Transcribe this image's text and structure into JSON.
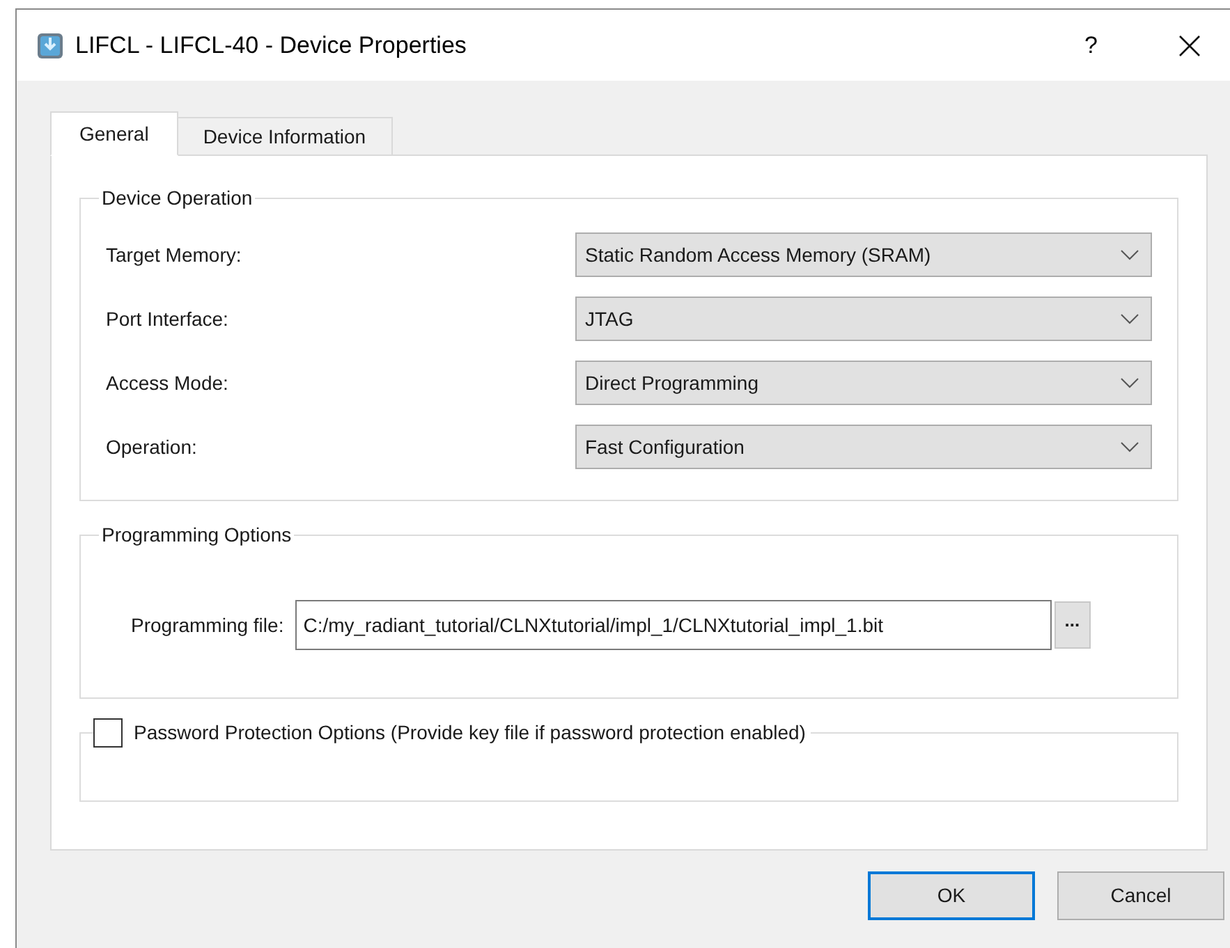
{
  "window": {
    "title": "LIFCL - LIFCL-40 - Device Properties",
    "help": "?"
  },
  "tabs": [
    {
      "label": "General",
      "selected": true
    },
    {
      "label": "Device Information",
      "selected": false
    }
  ],
  "device_operation": {
    "title": "Device Operation",
    "fields": [
      {
        "label": "Target Memory:",
        "value": "Static Random Access Memory (SRAM)"
      },
      {
        "label": "Port Interface:",
        "value": "JTAG"
      },
      {
        "label": "Access Mode:",
        "value": "Direct Programming"
      },
      {
        "label": "Operation:",
        "value": "Fast Configuration"
      }
    ]
  },
  "programming_options": {
    "title": "Programming Options",
    "file_label": "Programming file:",
    "file_value": "C:/my_radiant_tutorial/CLNXtutorial/impl_1/CLNXtutorial_impl_1.bit",
    "browse": "..."
  },
  "password": {
    "label": "Password Protection Options (Provide key file if password protection enabled)",
    "checked": false
  },
  "buttons": [
    {
      "label": "OK",
      "default": true
    },
    {
      "label": "Cancel",
      "default": false
    }
  ]
}
